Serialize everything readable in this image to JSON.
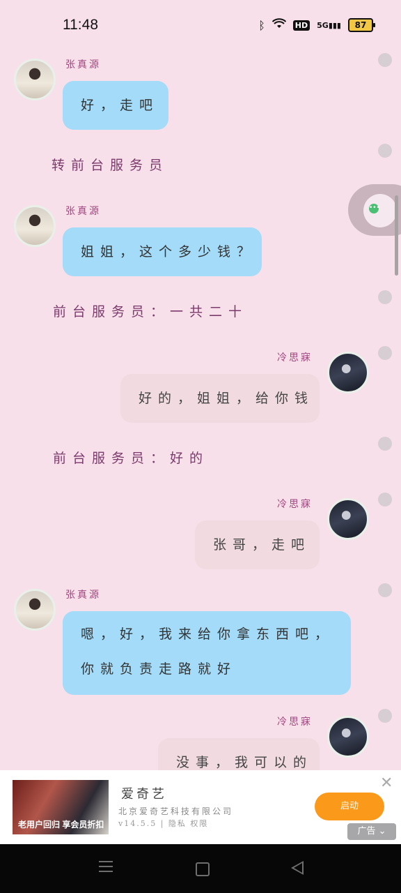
{
  "status_bar": {
    "time": "11:48",
    "network": "5G",
    "hd": "HD",
    "battery": "87"
  },
  "chat": {
    "messages": [
      {
        "type": "incoming",
        "sender": "张真源",
        "text": "好，走吧"
      },
      {
        "type": "system",
        "text": "转前台服务员"
      },
      {
        "type": "incoming",
        "sender": "张真源",
        "text": "姐姐，这个多少钱？"
      },
      {
        "type": "system",
        "text": "前台服务员：一共二十"
      },
      {
        "type": "outgoing",
        "sender": "冷思寐",
        "text": "好的，姐姐，给你钱"
      },
      {
        "type": "system",
        "text": "前台服务员：好的"
      },
      {
        "type": "outgoing",
        "sender": "冷思寐",
        "text": "张哥，走吧"
      },
      {
        "type": "incoming",
        "sender": "张真源",
        "text_lines": [
          "嗯，好，我来给你拿东西吧，",
          "你就负责走路就好"
        ]
      },
      {
        "type": "outgoing",
        "sender": "冷思寐",
        "text": "没事，我可以的"
      }
    ]
  },
  "ad": {
    "title": "爱奇艺",
    "company": "北京爱奇艺科技有限公司",
    "meta": "v14.5.5 | 隐私 权限",
    "image_text": "老用户回归 享会员折扣",
    "button": "启动",
    "tag": "广告",
    "close": "✕"
  },
  "colors": {
    "background": "#f8e0ea",
    "incoming_bubble": "#a3dbf8",
    "outgoing_bubble": "#f1dbe0",
    "name": "#a0467f",
    "system_text": "#7a3a6c",
    "ad_button": "#fb9a1a"
  },
  "icons": [
    "bluetooth-icon",
    "wifi-icon",
    "signal-icon",
    "battery-icon",
    "chat-bubble-icon",
    "close-icon",
    "menu-icon",
    "home-icon",
    "back-icon"
  ]
}
